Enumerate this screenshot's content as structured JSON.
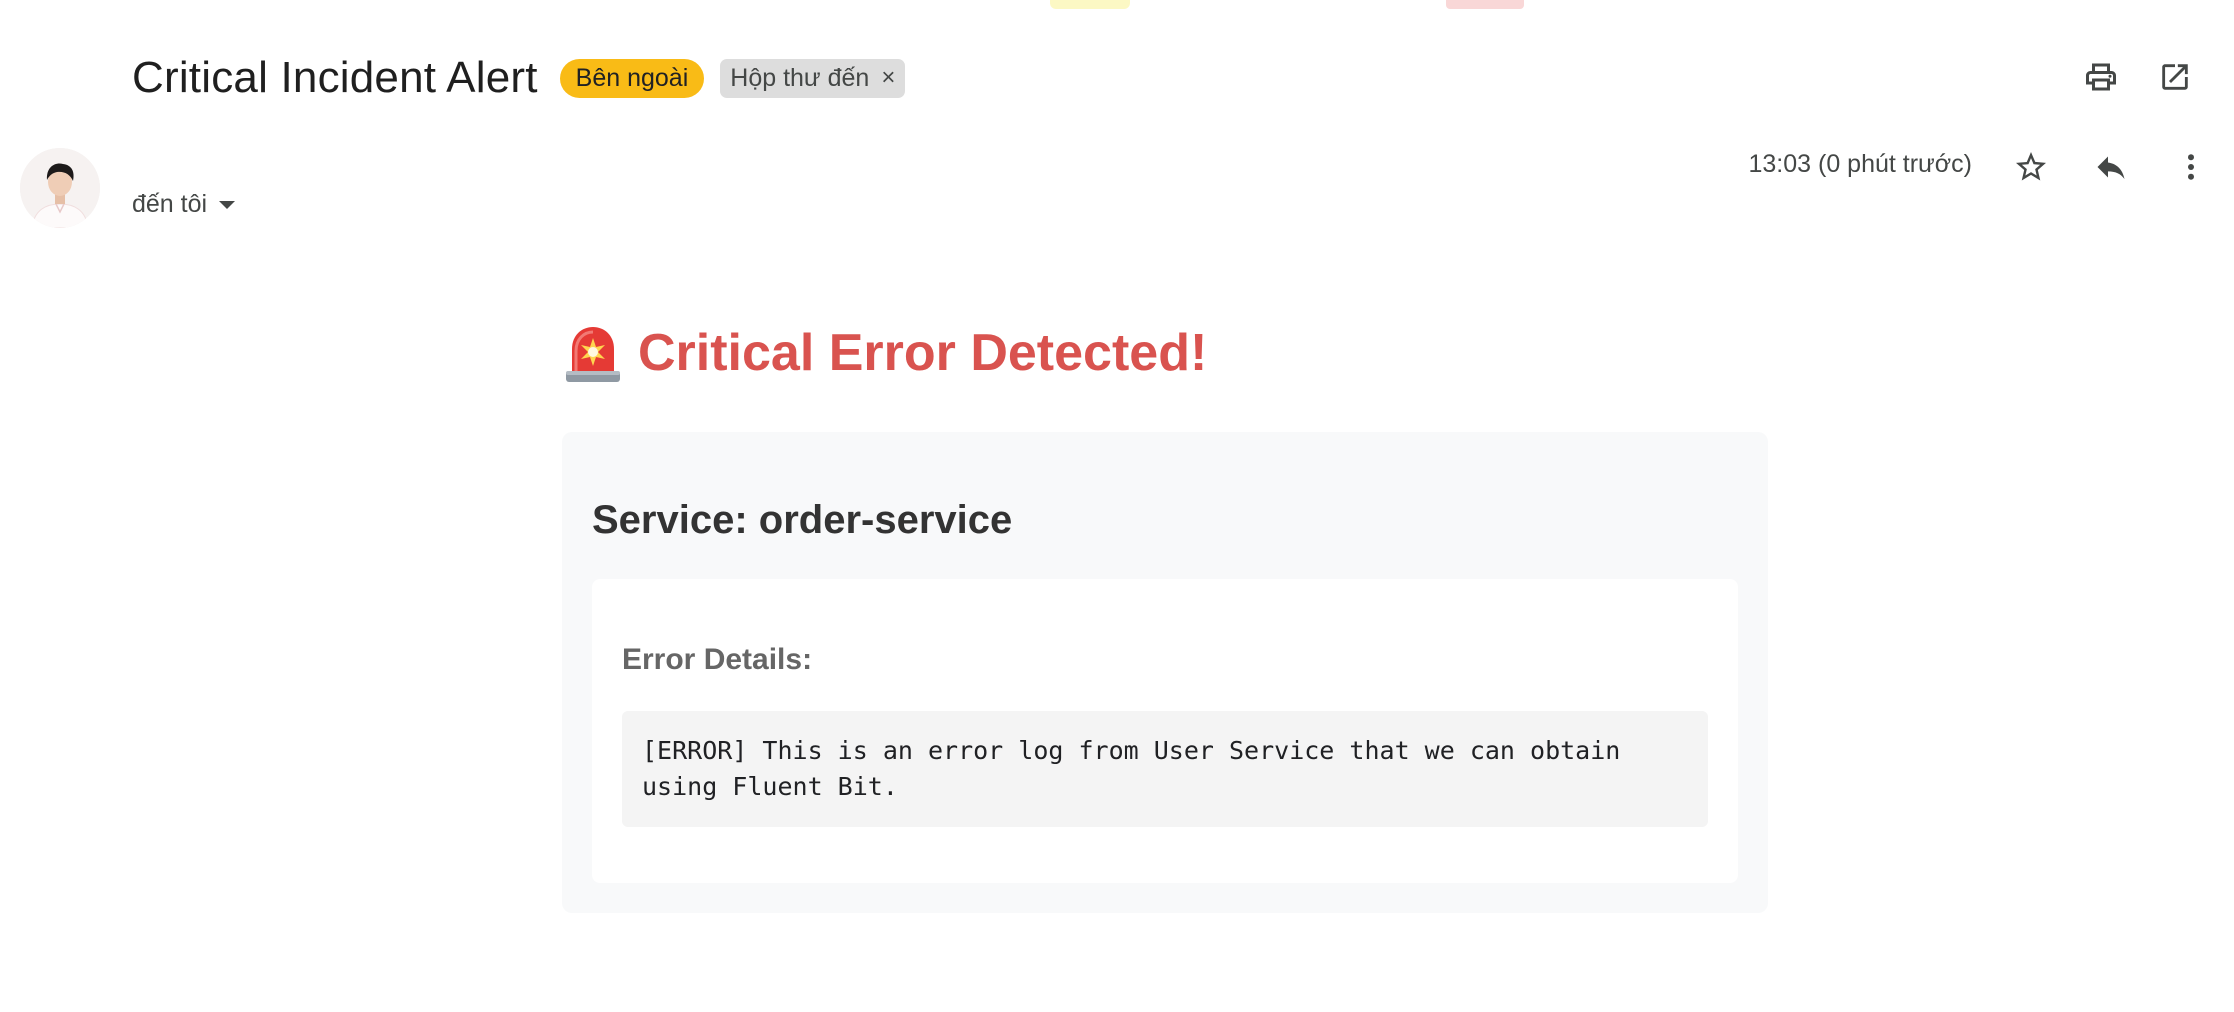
{
  "header": {
    "subject": "Critical Incident Alert",
    "labels": {
      "external": "Bên ngoài",
      "inbox": "Hộp thư đến",
      "inbox_remove": "×"
    },
    "icons": {
      "print": "print-icon",
      "open_new_window": "open-in-new-window-icon"
    }
  },
  "message": {
    "recipient": "đến tôi",
    "timestamp": "13:03 (0 phút trước)",
    "icons": {
      "star": "star-icon",
      "reply": "reply-icon",
      "more": "more-vertical-icon"
    }
  },
  "body": {
    "heading": "Critical Error Detected!",
    "heading_icon": "siren-icon",
    "service_title": "Service: order-service",
    "details_title": "Error Details:",
    "log_text": "[ERROR] This is an error log from User Service that we can obtain using Fluent Bit.",
    "colors": {
      "heading": "#d9534f",
      "external_label": "#f9bb16",
      "inbox_label": "#dddddd",
      "card_background": "#f8f9fa",
      "log_background": "#f4f4f4"
    }
  }
}
